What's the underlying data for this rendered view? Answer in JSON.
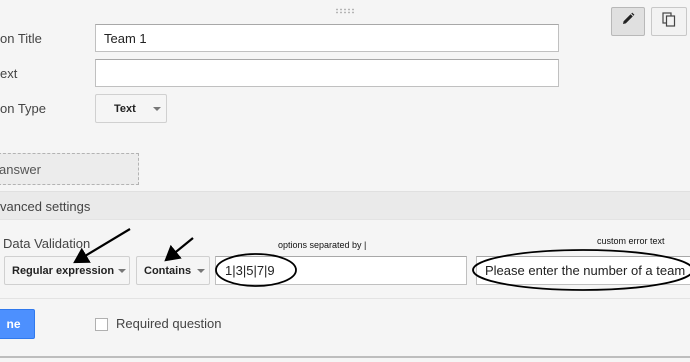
{
  "form": {
    "question_title_label": "on Title",
    "question_title_value": "Team 1",
    "help_text_label": "ext",
    "help_text_value": "",
    "question_type_label": "on Type",
    "question_type_value": "Text",
    "answer_placeholder": "answer",
    "advanced_settings_label": "vanced settings",
    "data_validation_label": "Data Validation",
    "validation_type": "Regular expression",
    "validation_condition": "Contains",
    "validation_pattern": "1|3|5|7|9",
    "custom_error_text": "Please enter the number of a team",
    "done_label": "ne",
    "required_label": "Required question"
  },
  "annotations": {
    "options_note": "options separated by |",
    "error_note": "custom error text"
  },
  "icons": {
    "edit": "pencil-icon",
    "duplicate": "duplicate-icon"
  },
  "colors": {
    "accent": "#4d90fe",
    "background": "#f5f5f5"
  }
}
